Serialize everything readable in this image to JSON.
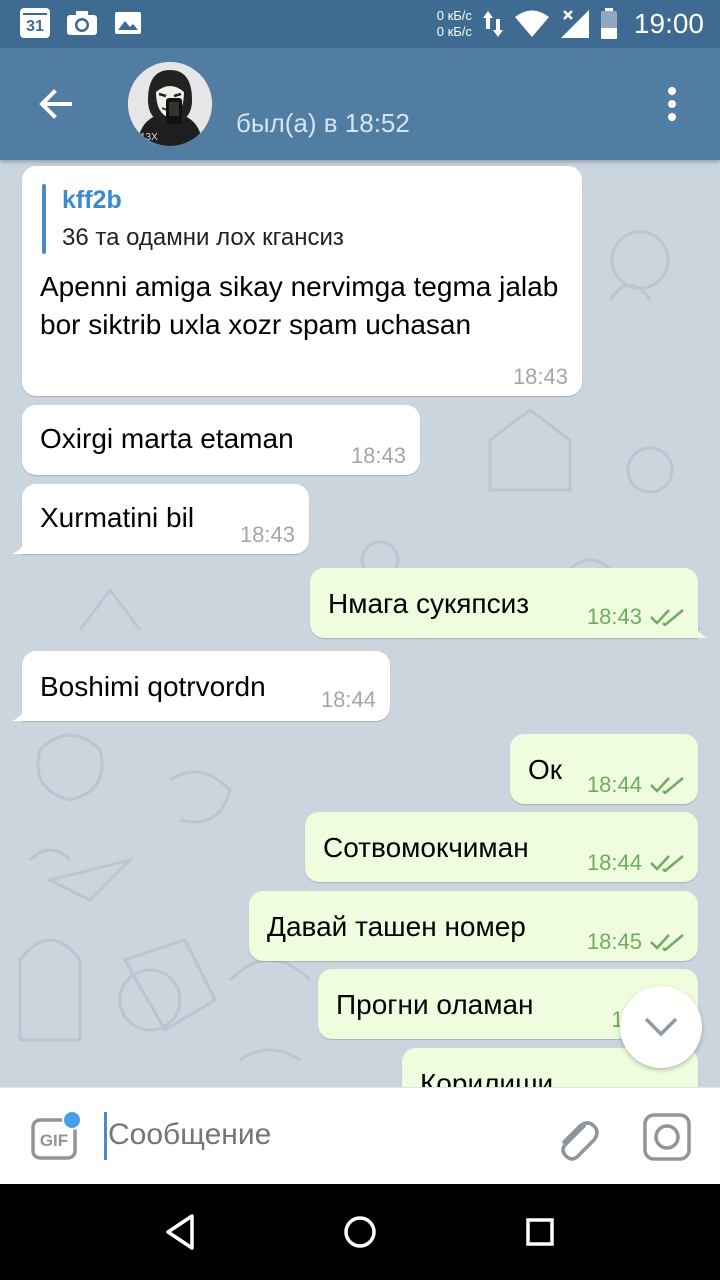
{
  "status_bar": {
    "speed_up": "0 кБ/с",
    "speed_down": "0 кБ/с",
    "time": "19:00",
    "calendar_day": "31",
    "icons": [
      "calendar-icon",
      "camera-icon",
      "image-icon",
      "data-arrows-icon",
      "wifi-icon",
      "signal-icon",
      "battery-icon"
    ]
  },
  "app_bar": {
    "presence": "был(а) в 18:52",
    "icons": [
      "back-arrow-icon",
      "avatar",
      "more-vertical-icon"
    ]
  },
  "messages": [
    {
      "direction": "in",
      "reply_name": "kff2b",
      "reply_text": "36 та одамни лох кгансиз",
      "text": "Apenni amiga sikay nervimga tegma jalab bor siktrib uxla xozr spam uchasan",
      "time": "18:43"
    },
    {
      "direction": "in",
      "text": "Oxirgi marta etaman",
      "time": "18:43"
    },
    {
      "direction": "in",
      "text": "Xurmatini bil",
      "time": "18:43"
    },
    {
      "direction": "out",
      "text": "Нмага сукяпсиз",
      "time": "18:43",
      "status": "read"
    },
    {
      "direction": "in",
      "text": "Boshimi qotrvordn",
      "time": "18:44"
    },
    {
      "direction": "out",
      "text": "Ок",
      "time": "18:44",
      "status": "read"
    },
    {
      "direction": "out",
      "text": "Сотвомокчиман",
      "time": "18:44",
      "status": "read"
    },
    {
      "direction": "out",
      "text": "Давай ташен номер",
      "time": "18:45",
      "status": "read"
    },
    {
      "direction": "out",
      "text": "Прогни оламан",
      "time": "18:",
      "status": "read"
    },
    {
      "direction": "out",
      "text": "Корилиши",
      "time": "",
      "status": ""
    }
  ],
  "input": {
    "placeholder": "Сообщение",
    "gif_label": "GIF"
  },
  "colors": {
    "header": "#517da2",
    "status_bar": "#3f6a91",
    "chat_bg": "#cad5de",
    "incoming": "#ffffff",
    "outgoing": "#effdde",
    "check": "#6cad62"
  }
}
